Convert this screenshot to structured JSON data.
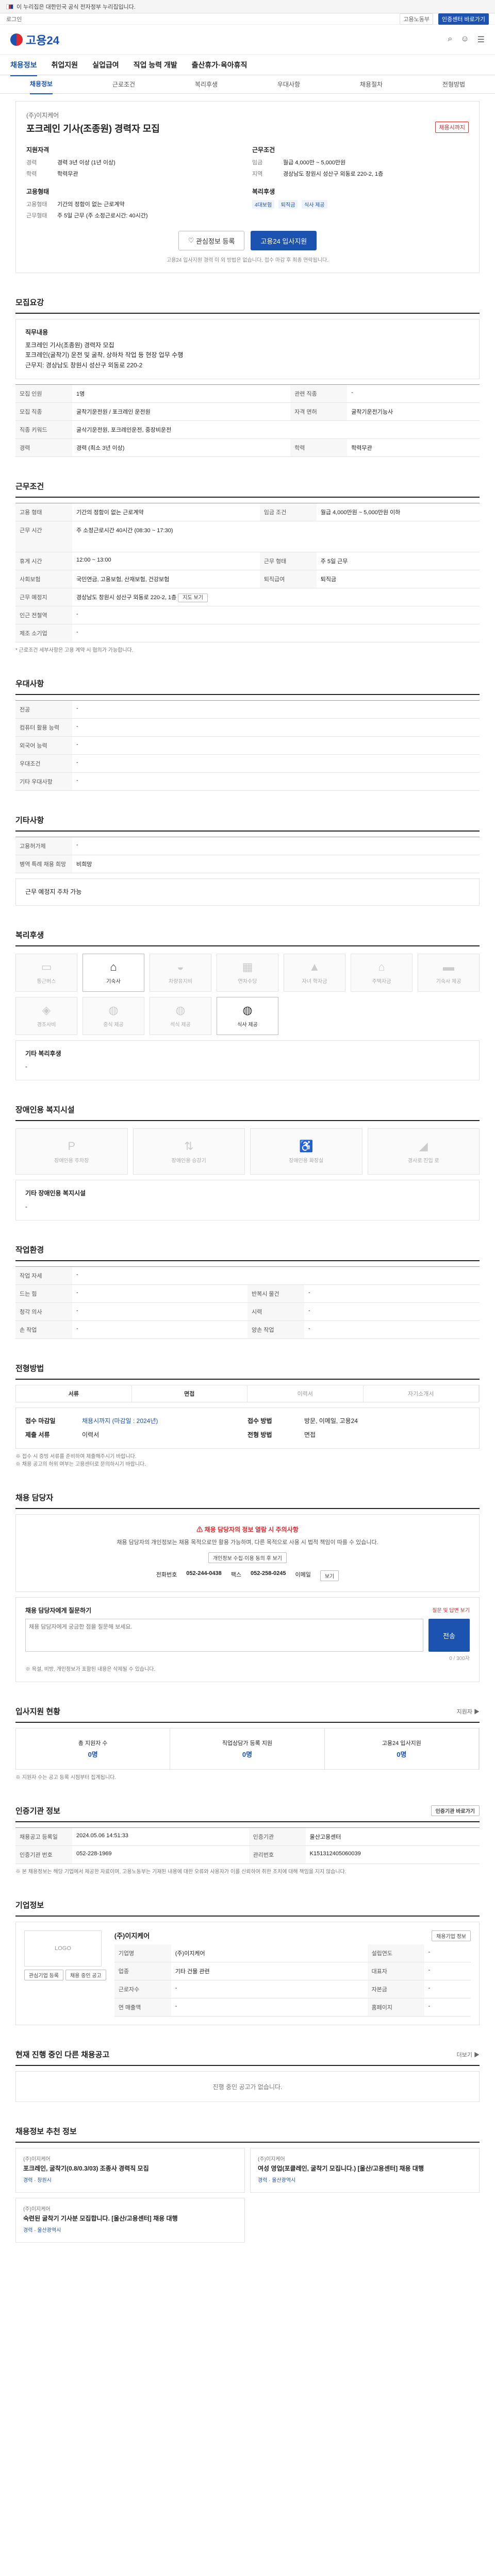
{
  "gov_banner": "이 누리집은 대한민국 공식 전자정부 누리집입니다.",
  "topbar": {
    "left": "로그인",
    "right1": "고용노동부",
    "right2": "인증센터 바로가기"
  },
  "header": {
    "logo": "고용24"
  },
  "gnb": [
    "채용정보",
    "취업지원",
    "실업급여",
    "직업 능력 개발",
    "출산휴가·육아휴직"
  ],
  "subtabs": [
    "채용정보",
    "근로조건",
    "복리후생",
    "우대사항",
    "채용절차",
    "전형방법"
  ],
  "summary": {
    "company": "(주)이지케어",
    "title": "포크레인 기사(조종원) 경력자 모집",
    "status": "채용시까지",
    "left_head": "지원자격",
    "left": [
      [
        "경력",
        "경력 3년 이상 (1년 이상)"
      ],
      [
        "학력",
        "학력무관"
      ]
    ],
    "right_head": "근무조건",
    "right": [
      [
        "임금",
        "월급 4,000만 ~ 5,000만원"
      ],
      [
        "지역",
        "경상남도 창원시 성산구 외동로 220-2, 1층"
      ]
    ],
    "left2_head": "고용형태",
    "left2": [
      [
        "고용형태",
        "기간의 정함이 없는 근로계약"
      ],
      [
        "근무형태",
        "주 5일 근무 (주 소정근로시간: 40시간)"
      ]
    ],
    "right2_head": "복리후생",
    "right2_tags": [
      "4대보험",
      "퇴직금",
      "식사 제공"
    ],
    "btn_interest": "관심정보 등록",
    "btn_apply": "고용24 입사지원",
    "note": "고용24 입사지원 경력 이 외 방법은 없습니다. 접수 마감 후 최종 연락됩니다."
  },
  "sections": {
    "recruit_title": "모집요강",
    "recruit_desc_head": "직무내용",
    "recruit_desc": "포크레인 기사(조종원) 경력자 모집\n포크레인(굴착기) 운전 및 굴착, 상하차 작업 등 현장 업무 수행\n근무지: 경상남도 창원시 성산구 외동로 220-2",
    "recruit_rows": [
      [
        "모집 인원",
        "1명"
      ],
      [
        "모집 직종",
        "굴착기운전원 / 포크레인 운전원"
      ],
      [
        "관련 직종",
        "-"
      ],
      [
        "직종 키워드",
        "굴삭기운전원, 포크레인운전, 중장비운전"
      ],
      [
        "경력",
        "경력 (최소 3년 이상)"
      ],
      [
        "학력",
        "학력무관"
      ],
      [
        "자격 면허",
        "굴착기운전기능사"
      ]
    ],
    "cond_title": "근무조건",
    "cond_rows": [
      [
        "고용 형태",
        "기간의 정함이 없는 근로계약"
      ],
      [
        "임금 조건",
        "월급 4,000만원 ~ 5,000만원 이하"
      ],
      [
        "근무 시간",
        "주 소정근로시간 40시간 (08:30 ~ 17:30)"
      ],
      [
        "휴게 시간",
        "12:00 ~ 13:00"
      ],
      [
        "근무 형태",
        "주 5일 근무"
      ],
      [
        "사회보험",
        "국민연금, 고용보험, 산재보험, 건강보험"
      ],
      [
        "퇴직급여",
        "퇴직금"
      ],
      [
        "근무 예정지",
        "경상남도 창원시 성산구 외동로 220-2, 1층"
      ],
      [
        "인근 전철역",
        "-"
      ],
      [
        "제조 소기업",
        "-"
      ]
    ],
    "cond_note": "* 근로조건 세부사항은 고용 계약 시 협의가 가능합니다.",
    "pref_title": "우대사항",
    "pref_rows": [
      [
        "전공",
        "-"
      ],
      [
        "컴퓨터 활용 능력",
        "-"
      ],
      [
        "외국어 능력",
        "-"
      ],
      [
        "우대조건",
        "-"
      ],
      [
        "기타 우대사항",
        "-"
      ]
    ],
    "other_title": "기타사항",
    "other_rows": [
      [
        "고용허가제",
        "-"
      ],
      [
        "병역 특례 채용 희망",
        "비희망"
      ]
    ],
    "other_note": "근무 예정지 주차 가능",
    "welfare_title": "복리후생",
    "welfare_items": [
      {
        "label": "통근버스",
        "icon": "bus-icon",
        "on": false
      },
      {
        "label": "기숙사",
        "icon": "house-icon",
        "on": true
      },
      {
        "label": "차량유지비",
        "icon": "car-icon",
        "on": false
      },
      {
        "label": "연차수당",
        "icon": "calendar-icon",
        "on": false
      },
      {
        "label": "자녀 학자금",
        "icon": "cap-icon",
        "on": false
      },
      {
        "label": "주택자금",
        "icon": "home-icon",
        "on": false
      },
      {
        "label": "기숙사 제공",
        "icon": "bed-icon",
        "on": false
      },
      {
        "label": "경조사비",
        "icon": "gift-icon",
        "on": false
      },
      {
        "label": "중식 제공",
        "icon": "meal-icon",
        "on": false
      },
      {
        "label": "석식 제공",
        "icon": "meal-icon",
        "on": false
      },
      {
        "label": "식사 제공",
        "icon": "meal-icon",
        "on": true
      }
    ],
    "welfare_etc_head": "기타 복리후생",
    "welfare_etc": "-",
    "disab_title": "장애인용 복지시설",
    "disab_items": [
      {
        "label": "장애인용 주차장",
        "icon": "parking-icon"
      },
      {
        "label": "장애인용 승강기",
        "icon": "elevator-icon"
      },
      {
        "label": "장애인용 화장실",
        "icon": "toilet-icon"
      },
      {
        "label": "경사로 진입 로",
        "icon": "ramp-icon"
      }
    ],
    "disab_etc_head": "기타 장애인용 복지시설",
    "disab_etc": "-",
    "env_title": "작업환경",
    "env_rows": [
      [
        "작업 자세",
        "-",
        "",
        ""
      ],
      [
        "드는 힘",
        "-",
        "반복시 물건",
        "-"
      ],
      [
        "청각 의사",
        "-",
        "시력",
        "-"
      ],
      [
        "손 작업",
        "-",
        "양손 작업",
        "-"
      ]
    ],
    "method_title": "전형방법",
    "method_steps": [
      "서류",
      "면접",
      "이력서",
      "자기소개서"
    ],
    "method_rows": [
      [
        "접수 마감일",
        "채용시까지 (마감일 : 2024년)"
      ],
      [
        "접수 방법",
        "방문, 이메일, 고용24"
      ],
      [
        "제출 서류",
        "이력서"
      ],
      [
        "전형 방법",
        "면접"
      ]
    ],
    "method_notes": "※ 접수 시 증빙 서류를 준비하여 제출해주시기 바랍니다.\n※ 채용 공고의 허위 여부는 고용센터로 문의하시기 바랍니다.",
    "contact_title": "채용 담당자",
    "contact_warn": "채용 담당자의 정보 열람 시 주의사항",
    "contact_desc": "채용 담당자의 개인정보는 채용 목적으로만 활용 가능하며, 다른 목적으로 사용 시 법적 책임이 따를 수 있습니다.",
    "contact_btn": "개인정보 수집·이용 동의 후 보기",
    "contact_tel_label": "전화번호",
    "contact_tel": "052-244-0438",
    "contact_fax_label": "팩스",
    "contact_fax": "052-258-0245",
    "contact_email_label": "이메일",
    "contact_email_btn": "보기",
    "q_head": "채용 담당자에게 질문하기",
    "q_link": "질문 및 답변 보기",
    "q_placeholder": "채용 담당자에게 궁금한 점을 질문해 보세요.",
    "q_count": "0 / 300자",
    "q_btn": "전송",
    "q_note": "※ 욕설, 비방, 개인정보가 포함된 내용은 삭제될 수 있습니다.",
    "apply_stat_title": "입사지원 현황",
    "apply_stat_right": "지원자 ▶",
    "apply_stats": [
      [
        "총 지원자 수",
        "0명"
      ],
      [
        "직업상담가 등록 지원",
        "0명"
      ],
      [
        "고용24 입사지원",
        "0명"
      ]
    ],
    "apply_stat_note": "※ 지원자 수는 공고 등록 시점부터 집계됩니다.",
    "manage_title": "인증기관 정보",
    "manage_btn": "인증기관 바로가기",
    "manage_rows": [
      [
        "채용공고 등록일",
        "2024.05.06 14:51:33",
        "인증기관",
        "울산고용센터"
      ],
      [
        "인증기관 번호",
        "052-228-1969",
        "관리번호",
        "K151312405060039"
      ]
    ],
    "manage_note": "※ 본 채용정보는 해당 기업에서 제공한 자료이며, 고용노동부는 기재된 내용에 대한 오류와 사용자가 이를 신뢰하여 취한 조치에 대해 책임을 지지 않습니다.",
    "co_title": "기업정보",
    "co_btn": "채용기업 정보",
    "co_logo": "LOGO",
    "co_name": "(주)이지케어",
    "co_rows": [
      [
        "기업명",
        "(주)이지케어",
        "설립연도",
        "-"
      ],
      [
        "업종",
        "기타 건물 관련",
        "대표자",
        "-"
      ],
      [
        "근로자수",
        "-",
        "자본금",
        "-"
      ],
      [
        "연 매출액",
        "-",
        "홈페이지",
        "-"
      ]
    ],
    "co_btn2": "관심기업 등록",
    "co_btn3": "채용 중인 공고",
    "same_title": "현재 진행 중인 다른 채용공고",
    "same_right": "더보기 ▶",
    "same_empty": "진행 중인 공고가 없습니다.",
    "rec_title": "채용정보 추천 정보",
    "recs": [
      {
        "co": "(주)이지케어",
        "title": "포크레인, 굴착기(0.8/0.3/03) 조종사 경력직 모집",
        "meta": "경력 · 창원시"
      },
      {
        "co": "(주)이지케어",
        "title": "여성 영업(포클레인, 굴착기 모집니다.) [울산/고용센터] 채용 대행",
        "meta": "경력 · 울산광역시"
      },
      {
        "co": "(주)이지케어",
        "title": "숙련된 굴착기 기사분 모집합니다. [울산/고용센터] 채용 대행",
        "meta": "경력 · 울산광역시"
      }
    ]
  },
  "colors": {
    "accent": "#1c53b1",
    "warn": "#e0292d"
  }
}
